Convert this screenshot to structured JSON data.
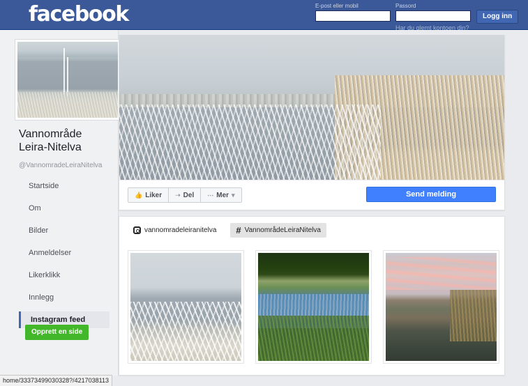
{
  "topbar": {
    "logo": "facebook",
    "email_label": "E-post eller mobil",
    "email_value": "",
    "email_placeholder": "",
    "password_label": "Passord",
    "password_value": "",
    "password_placeholder": "",
    "login_button": "Logg inn",
    "forgot_link": "Har du glemt kontoen din?",
    "brand_color": "#3b5998",
    "button_color": "#4267b2"
  },
  "profile": {
    "photo_alt": "frost-lake-profile-photo",
    "name": "Vannområde\nLeira-Nitelva",
    "name_line1": "Vannområde",
    "name_line2": "Leira-Nitelva",
    "handle": "@VannomradeLeiraNitelva"
  },
  "sidebar": {
    "items": [
      {
        "label": "Startside",
        "active": false
      },
      {
        "label": "Om",
        "active": false
      },
      {
        "label": "Bilder",
        "active": false
      },
      {
        "label": "Anmeldelser",
        "active": false
      },
      {
        "label": "Likerklikk",
        "active": false
      },
      {
        "label": "Innlegg",
        "active": false
      },
      {
        "label": "Instagram feed",
        "active": true
      }
    ],
    "create_page_button": "Opprett en side",
    "create_page_color": "#42b72a",
    "active_accent_color": "#4267b2"
  },
  "cover": {
    "photo_alt": "frost-covered-lake-and-reeds-cover-photo"
  },
  "actions": {
    "like_label": "Liker",
    "like_icon": "thumbs-up-icon",
    "share_label": "Del",
    "share_icon": "share-arrow-icon",
    "more_label": "Mer",
    "more_icon": "ellipsis-icon",
    "more_caret": "▾",
    "send_message_label": "Send melding",
    "send_message_color": "#4080ff"
  },
  "feed": {
    "tabs": [
      {
        "label": "vannomradeleiranitelva",
        "icon": "instagram-camera-icon",
        "selected": false
      },
      {
        "label": "VannområdeLeiraNitelva",
        "icon": "hashtag-icon",
        "selected": true
      }
    ],
    "hashtag_glyph": "#",
    "photos": [
      {
        "alt": "frosty-lakeshore-reeds-photo",
        "style": "ph-frost"
      },
      {
        "alt": "green-wetland-with-sky-reflection-photo",
        "style": "ph-wetland"
      },
      {
        "alt": "pink-sunset-over-river-photo",
        "style": "ph-sunset"
      }
    ]
  },
  "status_bar": {
    "url_text": "home/33373499030328?/4217038113"
  }
}
